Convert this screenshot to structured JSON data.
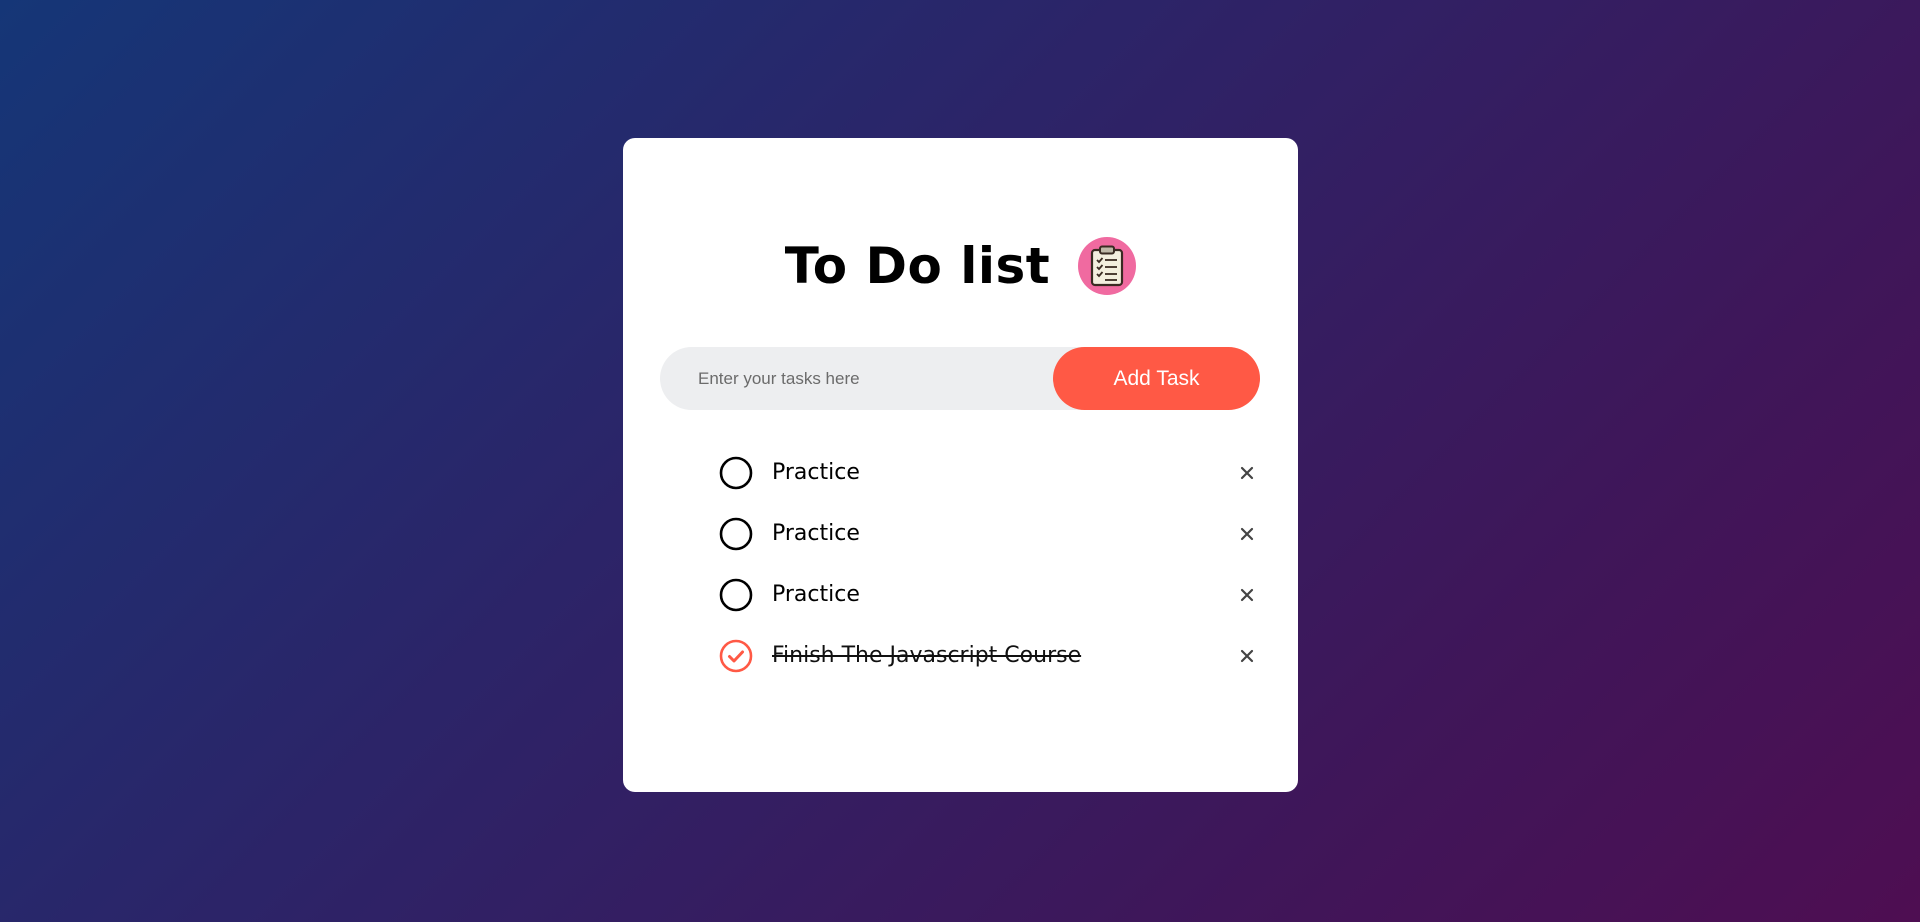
{
  "app": {
    "title": "To Do list",
    "title_icon": "clipboard-checklist-icon"
  },
  "input": {
    "placeholder": "Enter your tasks here",
    "value": ""
  },
  "add_button": {
    "label": "Add Task"
  },
  "tasks": [
    {
      "text": "Practice",
      "checked": false
    },
    {
      "text": "Practice",
      "checked": false
    },
    {
      "text": "Practice",
      "checked": false
    },
    {
      "text": "Finish The Javascript Course",
      "checked": true
    }
  ],
  "icons": {
    "unchecked": "circle-unchecked-icon",
    "checked": "check-circle-icon",
    "remove": "close-icon"
  },
  "colors": {
    "accent": "#ff5945",
    "background_start": "#153677",
    "background_end": "#4e0e52",
    "card": "#ffffff",
    "input_bg": "#edeef0",
    "icon_bg": "#f06aa0"
  }
}
